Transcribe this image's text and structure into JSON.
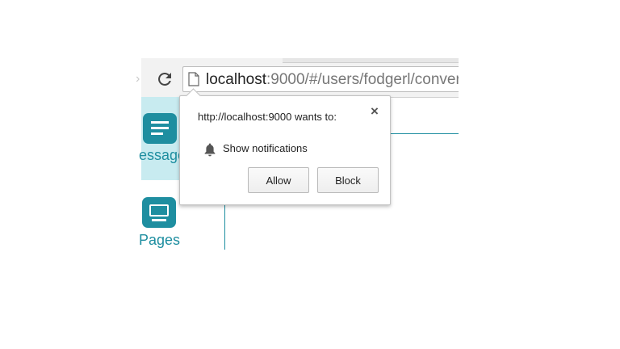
{
  "browser": {
    "address_host": "localhost",
    "address_rest": ":9000/#/users/fodgerl/conver"
  },
  "sidebar": {
    "items": [
      {
        "label": "essage",
        "icon": "messages-icon",
        "active": true
      },
      {
        "label": "Pages",
        "icon": "pages-icon",
        "active": false
      }
    ]
  },
  "permission_popup": {
    "title": "http://localhost:9000 wants to:",
    "permission_label": "Show notifications",
    "permission_icon": "bell-icon",
    "close_symbol": "×",
    "allow_label": "Allow",
    "block_label": "Block"
  },
  "colors": {
    "accent": "#1e8ea0",
    "active_nav_bg": "#c8ebf0",
    "toolbar_bg": "#f2f2f2"
  }
}
